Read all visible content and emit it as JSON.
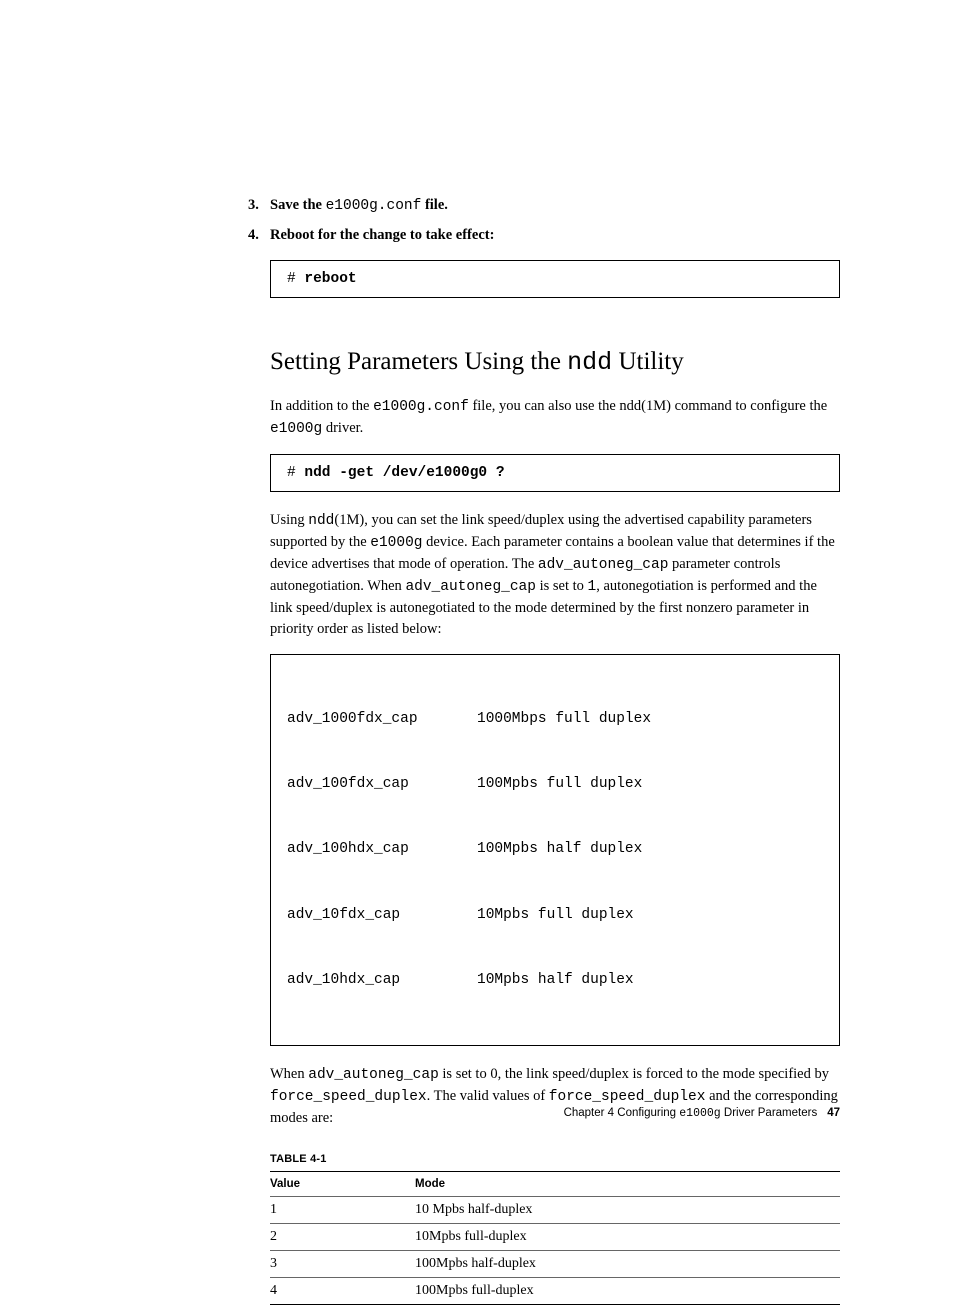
{
  "steps": {
    "s3": {
      "num": "3.",
      "pre": "Save the ",
      "code": "e1000g.conf",
      "post": " file."
    },
    "s4": {
      "num": "4.",
      "text": "Reboot for the change to take effect:"
    }
  },
  "codebox_reboot": {
    "prompt": "# ",
    "cmd": "reboot"
  },
  "section_title": {
    "pre": "Setting Parameters Using the ",
    "code": "ndd",
    "post": " Utility"
  },
  "para1": {
    "t1": "In addition to the ",
    "c1": "e1000g.conf",
    "t2": " file, you can also use the ndd(1M) command to configure the ",
    "c2": "e1000g",
    "t3": " driver."
  },
  "codebox_ndd": {
    "prompt": "# ",
    "cmd": "ndd -get /dev/e1000g0 ?"
  },
  "para2": {
    "t1": "Using ",
    "c1": "ndd",
    "t2": "(1M), you can set the link speed/duplex using the advertised capability parameters supported by the ",
    "c2": "e1000g",
    "t3": " device. Each parameter contains a boolean value that determines if the device advertises that mode of operation. The ",
    "c3": "adv_autoneg_cap",
    "t4": " parameter controls autonegotiation. When ",
    "c4": "adv_autoneg_cap",
    "t5": " is set to ",
    "c5": "1",
    "t6": ", autonegotiation is performed and the link speed/duplex is autonegotiated to the mode determined by the first nonzero parameter in priority order as listed below:"
  },
  "chart_data": {
    "type": "table",
    "rows": [
      {
        "param": "adv_1000fdx_cap",
        "desc": "1000Mbps full duplex"
      },
      {
        "param": "adv_100fdx_cap",
        "desc": "100Mpbs full duplex"
      },
      {
        "param": "adv_100hdx_cap",
        "desc": "100Mpbs half duplex"
      },
      {
        "param": "adv_10fdx_cap",
        "desc": "10Mpbs full duplex"
      },
      {
        "param": "adv_10hdx_cap",
        "desc": "10Mpbs half duplex"
      }
    ]
  },
  "para3": {
    "t1": "When ",
    "c1": "adv_autoneg_cap",
    "t2": " is set to 0, the link speed/duplex is forced to the mode specified by ",
    "c2": "force_speed_duplex",
    "t3": ". The valid values of ",
    "c3": "force_speed_duplex",
    "t4": " and the  corresponding modes are:"
  },
  "table_label": "TABLE 4-1",
  "table": {
    "headers": {
      "h1": "Value",
      "h2": "Mode"
    },
    "rows": [
      {
        "v": "1",
        "m": "10 Mpbs half-duplex"
      },
      {
        "v": "2",
        "m": "10Mpbs full-duplex"
      },
      {
        "v": "3",
        "m": "100Mpbs half-duplex"
      },
      {
        "v": "4",
        "m": "100Mpbs full-duplex"
      }
    ]
  },
  "footer": {
    "t1": "Chapter 4   Configuring ",
    "c1": "e1000g",
    "t2": " Driver Parameters",
    "page": "47"
  }
}
